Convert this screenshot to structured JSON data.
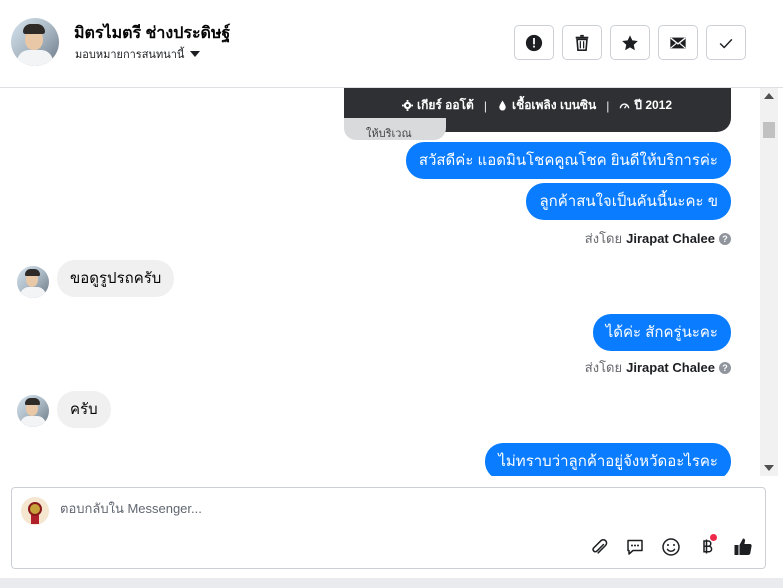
{
  "header": {
    "contact_name": "มิตรไมตรี ช่างประดิษฐ์",
    "assign_label": "มอบหมายการสนทนานี้",
    "actions": [
      {
        "name": "spam-button",
        "icon": "exclamation-circle-icon"
      },
      {
        "name": "delete-button",
        "icon": "trash-icon"
      },
      {
        "name": "star-button",
        "icon": "star-icon"
      },
      {
        "name": "mark-unread-button",
        "icon": "envelope-icon"
      },
      {
        "name": "mark-done-button",
        "icon": "check-icon"
      }
    ]
  },
  "car_card": {
    "gear": "เกียร์ ออโต้",
    "fuel": "เชื้อเพลิง เบนซิน",
    "year": "ปี 2012",
    "peek_text": "ให้บริเวณ"
  },
  "messages": {
    "out_1": "สวัสดีค่ะ แอดมินโชคคูณโชค ยินดีให้บริการค่ะ",
    "out_2": "ลูกค้าสนใจเป็นคันนี้นะคะ ข",
    "sent_by_prefix": "ส่งโดย",
    "sent_by_name": "Jirapat Chalee",
    "in_1": "ขอดูรูปรถครับ",
    "out_3": "ได้ค่ะ สักครู่นะคะ",
    "in_2": "ครับ",
    "out_4": "ไม่ทราบว่าลูกค้าอยู่จังหวัดอะไรคะ"
  },
  "composer": {
    "placeholder": "ตอบกลับใน Messenger...",
    "tools": [
      "paperclip-icon",
      "chat-bubble-icon",
      "smiley-icon",
      "baht-icon",
      "thumbs-up-icon"
    ]
  },
  "colors": {
    "outgoing_bubble": "#0a7cff",
    "incoming_bubble": "#f0f0f0",
    "like_icon": "#1c1e21",
    "notification_dot": "#f0284a"
  }
}
